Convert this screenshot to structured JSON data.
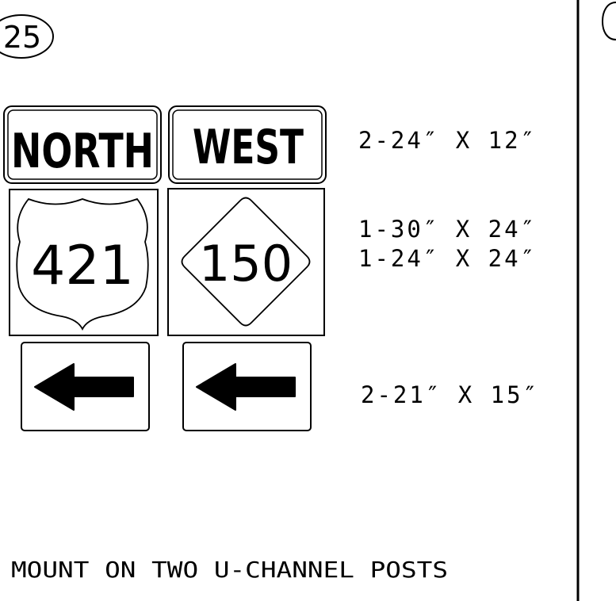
{
  "detail_number": "25",
  "signs": {
    "north_label": "NORTH",
    "west_label": "WEST",
    "us_route_number": "421",
    "state_route_number": "150"
  },
  "icons": {
    "us_route_shield": "us-route-shield-icon",
    "state_route_diamond": "state-route-diamond-icon",
    "left_arrow": "left-arrow-icon"
  },
  "dimensions": {
    "cardinal_signs": "2-24″ X 12″",
    "us_shield": "1-30″ X 24″",
    "state_marker": "1-24″ X 24″",
    "arrow_signs": "2-21″ X 15″"
  },
  "note": "MOUNT ON TWO U-CHANNEL POSTS",
  "colors": {
    "ink": "#000000",
    "paper": "#ffffff"
  }
}
